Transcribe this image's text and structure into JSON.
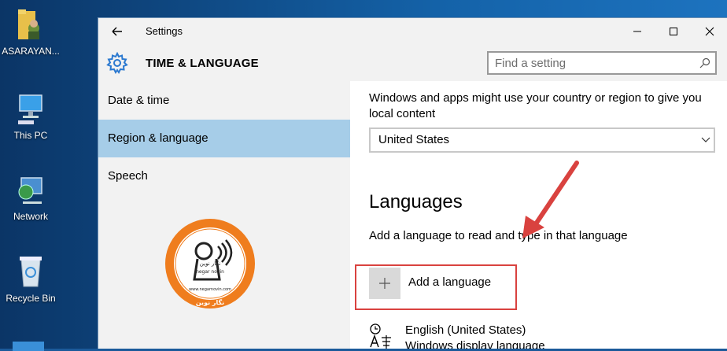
{
  "desktop": {
    "icons": [
      {
        "label": "ASARAYAN..."
      },
      {
        "label": "This PC"
      },
      {
        "label": "Network"
      },
      {
        "label": "Recycle Bin"
      }
    ]
  },
  "window": {
    "title": "Settings",
    "section_title": "TIME & LANGUAGE",
    "search_placeholder": "Find a setting"
  },
  "sidebar": {
    "items": [
      {
        "label": "Date & time",
        "active": false
      },
      {
        "label": "Region & language",
        "active": true
      },
      {
        "label": "Speech",
        "active": false
      }
    ],
    "logo": {
      "arc_text": "نگار نوین",
      "center_name": "negar novin",
      "url": "www.negarnovin.com",
      "bottom_text": "نگار نوین"
    }
  },
  "content": {
    "region_description": "Windows and apps might use your country or region to give you local content",
    "country_value": "United States",
    "languages_heading": "Languages",
    "add_description": "Add a language to read and type in that language",
    "add_language_label": "Add a language",
    "language_name": "English (United States)",
    "language_sub": "Windows display language"
  },
  "colors": {
    "accent": "#a6cde8",
    "gear": "#2b79d0",
    "highlight": "#d9423f",
    "logo_orange": "#ef7d1e"
  }
}
